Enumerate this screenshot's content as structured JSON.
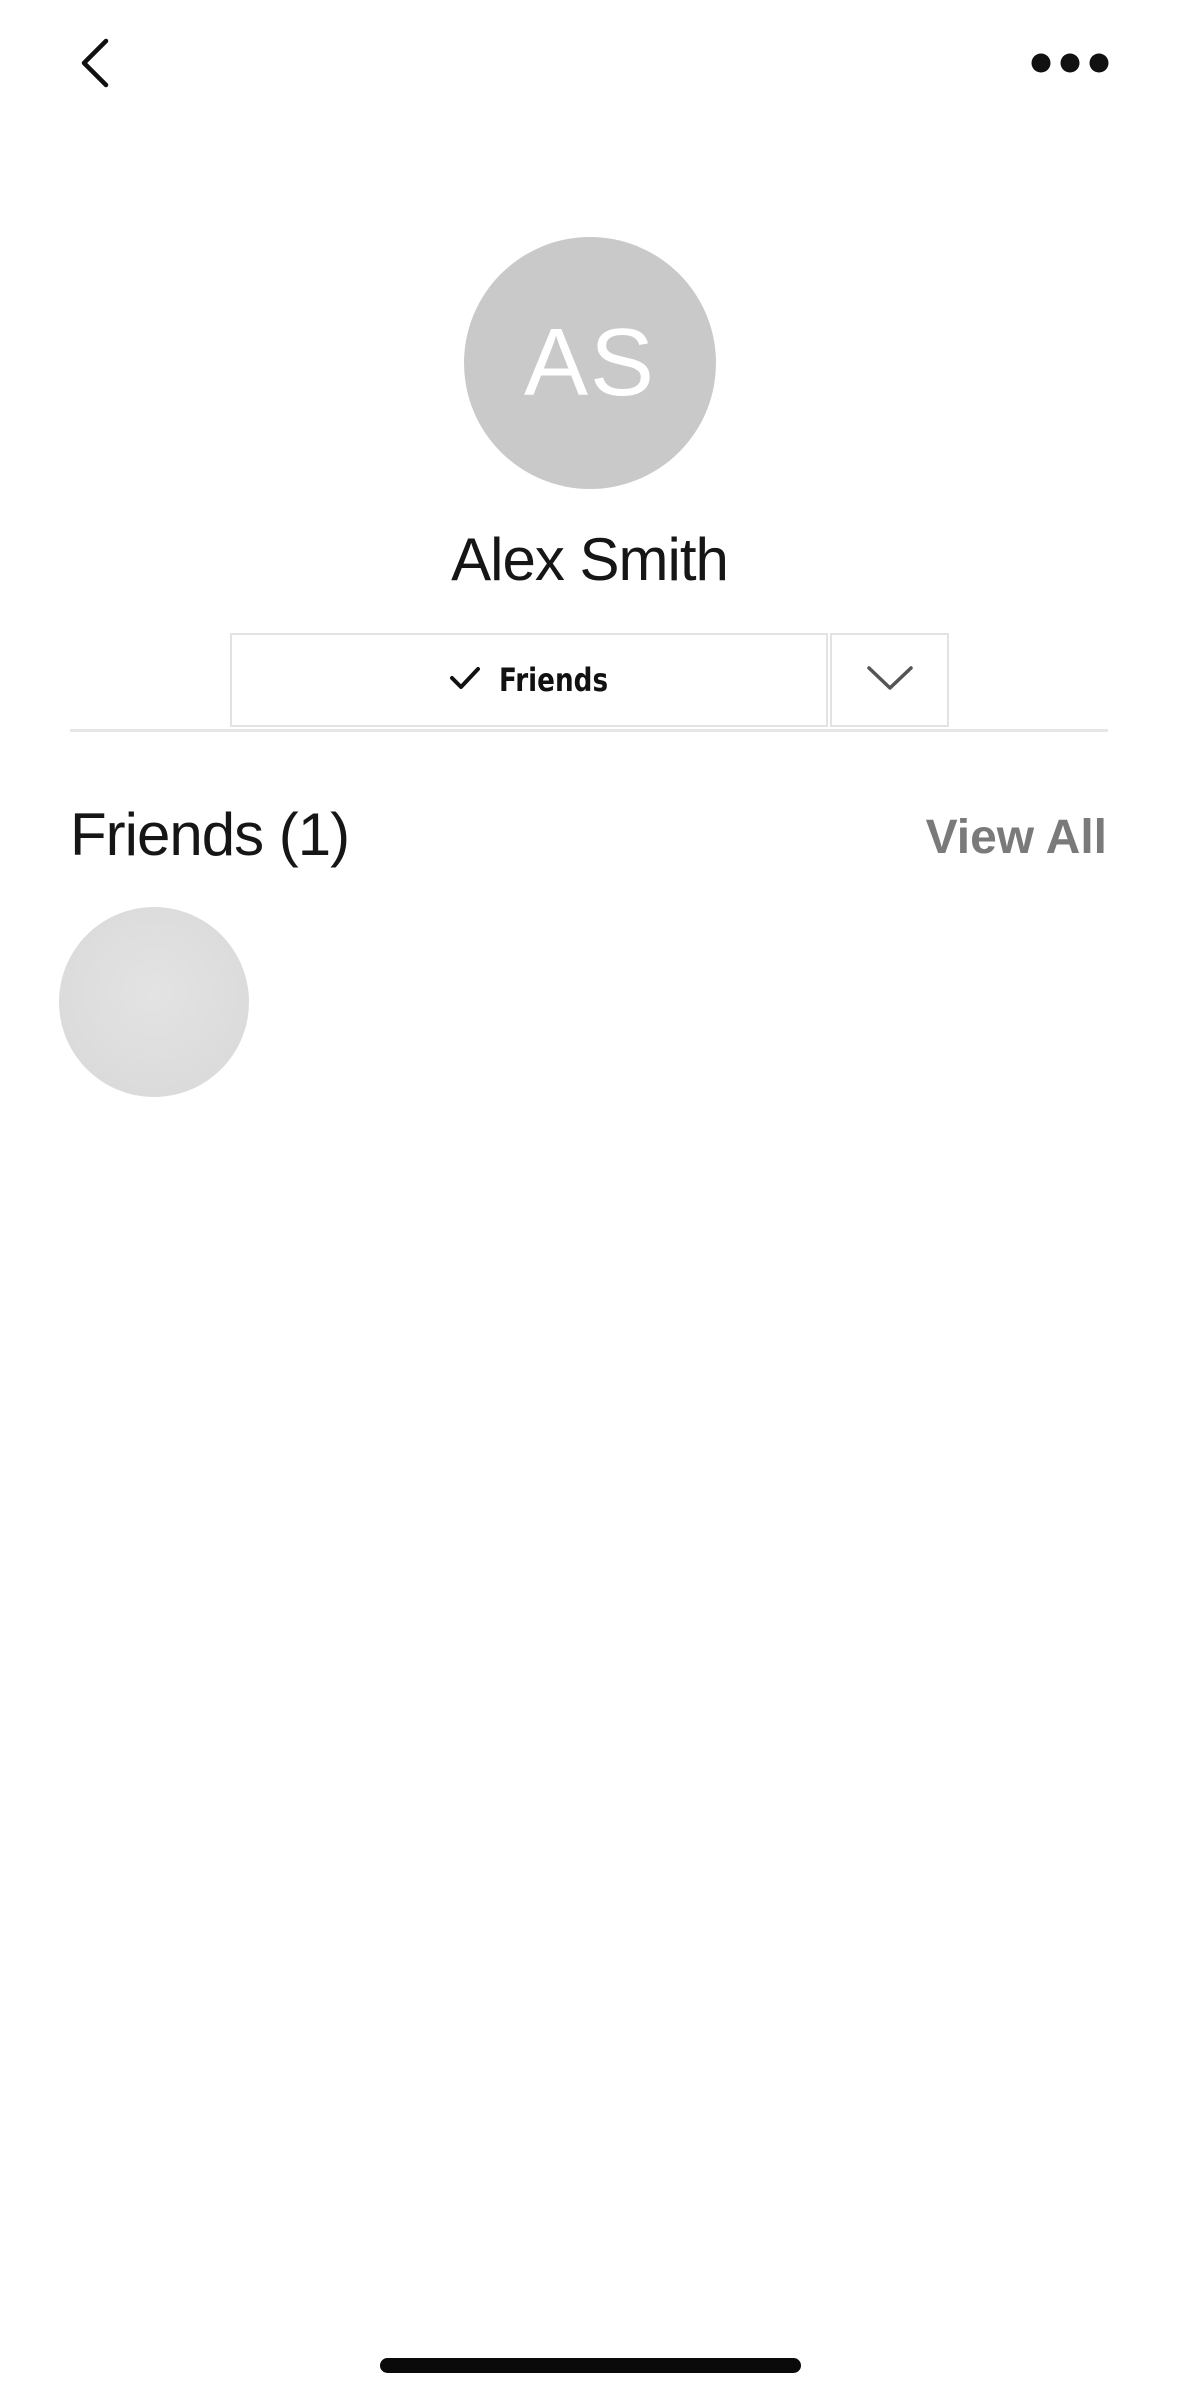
{
  "nav": {
    "back_icon": "chevron-left-icon",
    "more_icon": "ellipsis-icon"
  },
  "profile": {
    "initials": "AS",
    "name": "Alex Smith",
    "avatar_color": "#c9c9c9"
  },
  "relationship": {
    "status_label": "Friends",
    "status_icon": "checkmark-icon",
    "dropdown_icon": "chevron-down-icon"
  },
  "friends_section": {
    "title": "Friends (1)",
    "view_all_label": "View All",
    "view_all_color": "#7a7a7a",
    "friends": [
      {
        "avatar": "placeholder-avatar"
      }
    ]
  }
}
